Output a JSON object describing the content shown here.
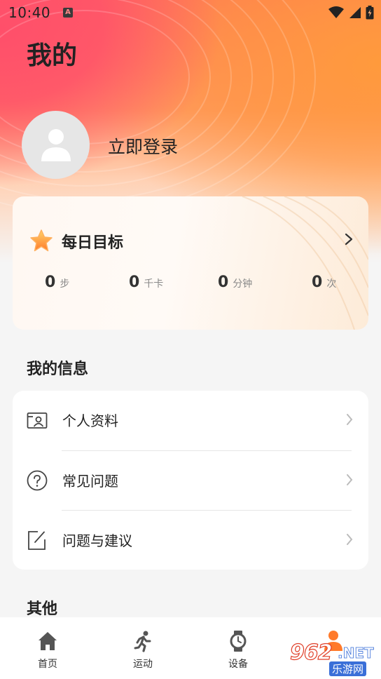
{
  "status_bar": {
    "time": "10:40",
    "app_icon": "A",
    "icons": [
      "wifi-icon",
      "cellular-signal-icon",
      "battery-charging-icon"
    ]
  },
  "page": {
    "title": "我的"
  },
  "profile": {
    "login_label": "立即登录",
    "avatar_icon": "person-icon"
  },
  "daily_goal": {
    "title": "每日目标",
    "icon": "star-icon",
    "stats": [
      {
        "value": "0",
        "unit": "步"
      },
      {
        "value": "0",
        "unit": "千卡"
      },
      {
        "value": "0",
        "unit": "分钟"
      },
      {
        "value": "0",
        "unit": "次"
      }
    ]
  },
  "my_info": {
    "title": "我的信息",
    "items": [
      {
        "label": "个人资料",
        "icon": "id-card-icon"
      },
      {
        "label": "常见问题",
        "icon": "question-circle-icon"
      },
      {
        "label": "问题与建议",
        "icon": "edit-note-icon"
      }
    ]
  },
  "other": {
    "title": "其他"
  },
  "tab_bar": {
    "tabs": [
      {
        "label": "首页",
        "icon": "home-icon"
      },
      {
        "label": "运动",
        "icon": "running-icon"
      },
      {
        "label": "设备",
        "icon": "watch-icon"
      },
      {
        "label": "",
        "icon": "profile-icon"
      }
    ],
    "active_color": "#ff7a2a"
  },
  "watermark": {
    "number": "962",
    "net": ".NET",
    "site_name": "乐游网"
  },
  "colors": {
    "accent": "#ff7a2a",
    "gradient_pink": "#ff4f6a",
    "gradient_orange": "#ff9a3c"
  }
}
